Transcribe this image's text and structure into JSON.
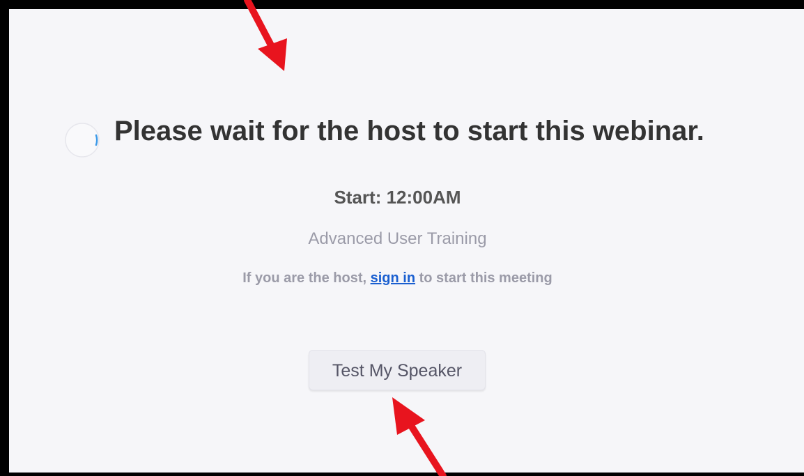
{
  "waiting_message": "Please wait for the host to start this webinar.",
  "start_time": "Start: 12:00AM",
  "meeting_name": "Advanced User Training",
  "host_prompt": {
    "before": "If you are the host, ",
    "link": "sign in",
    "after": " to start this meeting"
  },
  "test_speaker_button": "Test My Speaker",
  "colors": {
    "background": "#f6f6f9",
    "link": "#1a5fd0",
    "annotation_arrow": "#e8141e"
  }
}
